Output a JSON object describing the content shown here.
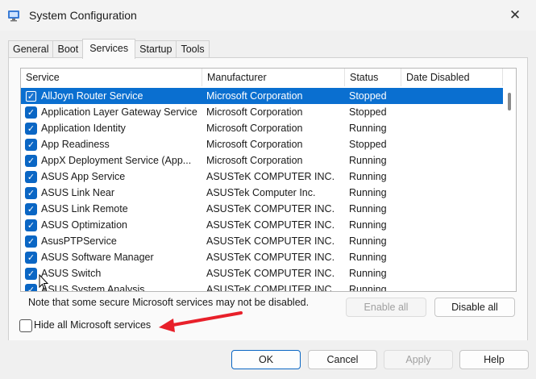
{
  "window": {
    "title": "System Configuration"
  },
  "tabs": [
    {
      "label": "General"
    },
    {
      "label": "Boot"
    },
    {
      "label": "Services"
    },
    {
      "label": "Startup"
    },
    {
      "label": "Tools"
    }
  ],
  "columns": [
    "Service",
    "Manufacturer",
    "Status",
    "Date Disabled"
  ],
  "rows": [
    {
      "name": "AllJoyn Router Service",
      "manufacturer": "Microsoft Corporation",
      "status": "Stopped",
      "date": ""
    },
    {
      "name": "Application Layer Gateway Service",
      "manufacturer": "Microsoft Corporation",
      "status": "Stopped",
      "date": ""
    },
    {
      "name": "Application Identity",
      "manufacturer": "Microsoft Corporation",
      "status": "Running",
      "date": ""
    },
    {
      "name": "App Readiness",
      "manufacturer": "Microsoft Corporation",
      "status": "Stopped",
      "date": ""
    },
    {
      "name": "AppX Deployment Service (App...",
      "manufacturer": "Microsoft Corporation",
      "status": "Running",
      "date": ""
    },
    {
      "name": "ASUS App Service",
      "manufacturer": "ASUSTeK COMPUTER INC.",
      "status": "Running",
      "date": ""
    },
    {
      "name": "ASUS Link Near",
      "manufacturer": "ASUSTek Computer Inc.",
      "status": "Running",
      "date": ""
    },
    {
      "name": "ASUS Link Remote",
      "manufacturer": "ASUSTeK COMPUTER INC.",
      "status": "Running",
      "date": ""
    },
    {
      "name": "ASUS Optimization",
      "manufacturer": "ASUSTeK COMPUTER INC.",
      "status": "Running",
      "date": ""
    },
    {
      "name": "AsusPTPService",
      "manufacturer": "ASUSTeK COMPUTER INC.",
      "status": "Running",
      "date": ""
    },
    {
      "name": "ASUS Software Manager",
      "manufacturer": "ASUSTeK COMPUTER INC.",
      "status": "Running",
      "date": ""
    },
    {
      "name": "ASUS Switch",
      "manufacturer": "ASUSTeK COMPUTER INC.",
      "status": "Running",
      "date": ""
    },
    {
      "name": "ASUS System Analysis",
      "manufacturer": "ASUSTeK COMPUTER INC.",
      "status": "Running",
      "date": ""
    }
  ],
  "note": "Note that some secure Microsoft services may not be disabled.",
  "buttons": {
    "enable_all": "Enable all",
    "disable_all": "Disable all",
    "ok": "OK",
    "cancel": "Cancel",
    "apply": "Apply",
    "help": "Help"
  },
  "hide_ms": {
    "label": "Hide all Microsoft services",
    "checked": false
  },
  "icons": {
    "close": "close-icon",
    "app": "system-config-icon",
    "check": "checkmark-icon"
  },
  "colors": {
    "selection": "#0a6fd0",
    "checkbox": "#0a66c4",
    "arrow": "#e8202a"
  }
}
